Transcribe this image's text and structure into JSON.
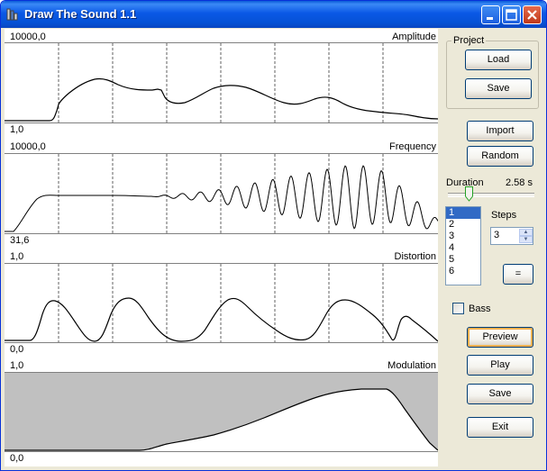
{
  "window": {
    "title": "Draw The Sound 1.1"
  },
  "panels": {
    "amplitude": {
      "label": "Amplitude",
      "max": "10000,0",
      "min": "1,0"
    },
    "frequency": {
      "label": "Frequency",
      "max": "10000,0",
      "min": "31,6"
    },
    "distortion": {
      "label": "Distortion",
      "max": "1,0",
      "min": "0,0"
    },
    "modulation": {
      "label": "Modulation",
      "max": "1,0",
      "min": "0,0"
    }
  },
  "project": {
    "title": "Project",
    "load": "Load",
    "save": "Save"
  },
  "actions": {
    "import": "Import",
    "random": "Random"
  },
  "duration": {
    "label": "Duration",
    "value": "2.58 s"
  },
  "steps": {
    "label": "Steps",
    "value": "3",
    "equal_button": "=",
    "list": [
      "1",
      "2",
      "3",
      "4",
      "5",
      "6"
    ],
    "selected": "1"
  },
  "bass": {
    "label": "Bass",
    "checked": false
  },
  "playback": {
    "preview": "Preview",
    "play": "Play",
    "save": "Save",
    "exit": "Exit"
  },
  "colors": {
    "titlebar": "#0a58e6",
    "plot_line": "#000000",
    "modulation_fill": "#c0c0c0",
    "selection": "#316ac5"
  }
}
